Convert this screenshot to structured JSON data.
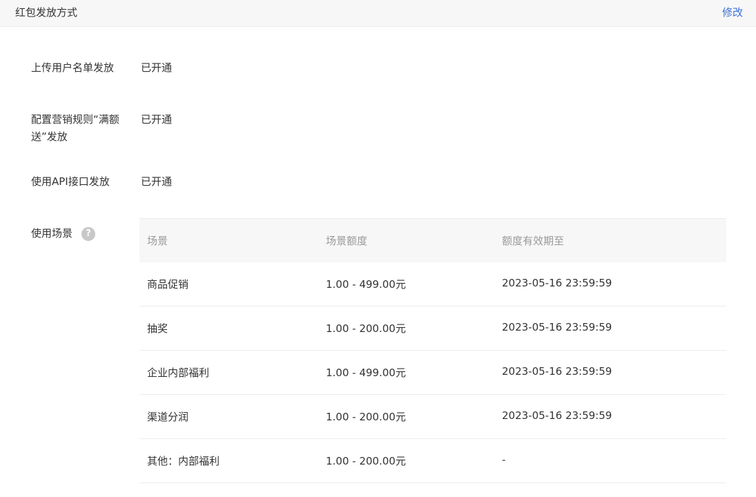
{
  "header": {
    "title": "红包发放方式",
    "edit_label": "修改"
  },
  "rows": [
    {
      "label": "上传用户名单发放",
      "value": "已开通"
    },
    {
      "label": "配置营销规则“满额送”发放",
      "value": "已开通"
    },
    {
      "label": "使用API接口发放",
      "value": "已开通"
    }
  ],
  "scenes": {
    "label": "使用场景",
    "help_icon": "question-circle-icon",
    "headers": [
      "场景",
      "场景额度",
      "额度有效期至"
    ],
    "items": [
      {
        "scene": "商品促销",
        "amount": "1.00 - 499.00元",
        "expiry": "2023-05-16 23:59:59"
      },
      {
        "scene": "抽奖",
        "amount": "1.00 - 200.00元",
        "expiry": "2023-05-16 23:59:59"
      },
      {
        "scene": "企业内部福利",
        "amount": "1.00 - 499.00元",
        "expiry": "2023-05-16 23:59:59"
      },
      {
        "scene": "渠道分润",
        "amount": "1.00 - 200.00元",
        "expiry": "2023-05-16 23:59:59"
      },
      {
        "scene": "其他：内部福利",
        "amount": "1.00 - 200.00元",
        "expiry": "-"
      }
    ]
  },
  "colors": {
    "link": "#3d6fd8",
    "header_bg": "#f7f7f7",
    "muted_text": "#999999"
  }
}
